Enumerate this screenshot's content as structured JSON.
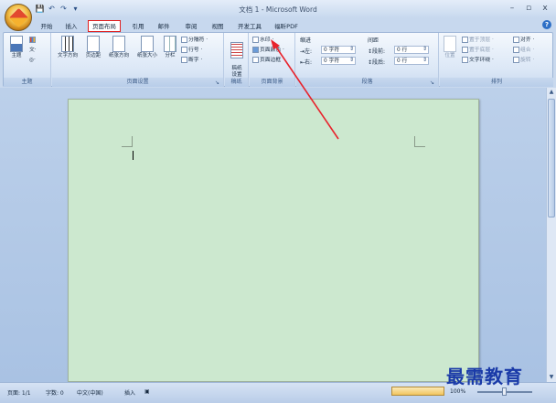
{
  "window": {
    "title": "文档 1 - Microsoft Word",
    "controls": {
      "minimize": "–",
      "restore": "▫",
      "close": "x"
    }
  },
  "qat": {
    "save": "💾",
    "undo": "↶",
    "redo": "↷",
    "more": "▾"
  },
  "tabs": [
    {
      "label": "开始"
    },
    {
      "label": "插入"
    },
    {
      "label": "页面布局",
      "active": true
    },
    {
      "label": "引用"
    },
    {
      "label": "邮件"
    },
    {
      "label": "审阅"
    },
    {
      "label": "视图"
    },
    {
      "label": "开发工具"
    },
    {
      "label": "福昕PDF"
    }
  ],
  "help": "?",
  "ribbon": {
    "theme": {
      "label": "主题",
      "buttons": {
        "themes": "主题",
        "colors": "",
        "fonts": "文·",
        "effects": "◎·"
      }
    },
    "page_setup": {
      "label": "页面设置",
      "big": [
        "文字方向",
        "页边距",
        "纸张方向",
        "纸张大小",
        "分栏"
      ],
      "small": [
        "分隔符 ·",
        "行号 ·",
        "断字 ·"
      ]
    },
    "page_bg_draft": {
      "label": "稿纸",
      "button": "稿纸\n设置"
    },
    "page_background": {
      "label": "页面背景",
      "small": [
        "水印 ·",
        "页面颜色 ·",
        "页面边框"
      ]
    },
    "paragraph": {
      "label": "段落",
      "indent_title": "缩进",
      "spacing_title": "间距",
      "indent_left_label": "左:",
      "indent_left_value": "0 字符",
      "indent_right_label": "右:",
      "indent_right_value": "0 字符",
      "spacing_before_label": "段前:",
      "spacing_before_value": "0 行",
      "spacing_after_label": "段后:",
      "spacing_after_value": "0 行"
    },
    "arrange": {
      "label": "排列",
      "big": "位置",
      "small": [
        "置于顶层 ·",
        "置于底层 ·",
        "文字环绕 ·",
        "对齐 ·",
        "组合 ·",
        "旋转 ·"
      ]
    }
  },
  "status": {
    "page": "页面: 1/1",
    "words": "字数: 0",
    "language": "中文(中国)",
    "insert": "插入",
    "zoom": "100%"
  },
  "watermark": "最需教育"
}
